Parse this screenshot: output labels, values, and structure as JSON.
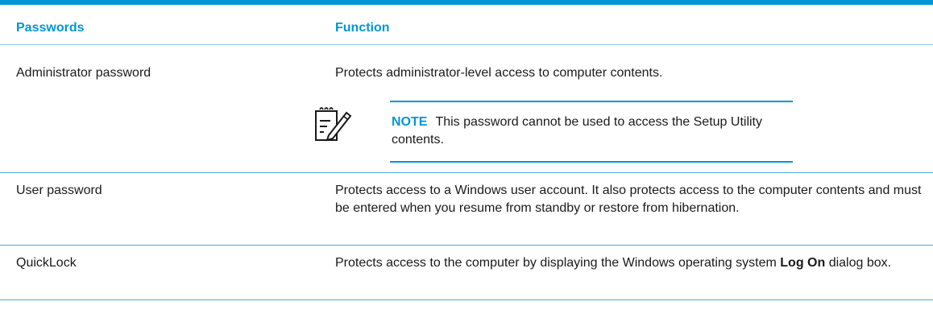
{
  "header": {
    "col_passwords": "Passwords",
    "col_function": "Function"
  },
  "rows": [
    {
      "password": "Administrator password",
      "function": "Protects administrator-level access to computer contents."
    },
    {
      "password": "User password",
      "function": "Protects access to a Windows user account. It also protects access to the computer contents and must be entered when you resume from standby or restore from hibernation."
    },
    {
      "password": "QuickLock",
      "function_prefix": "Protects access to the computer by displaying the Windows operating system",
      "function_bold": "Log On",
      "function_suffix": "dialog box."
    }
  ],
  "note": {
    "label": "NOTE",
    "text": "This password cannot be used to access the Setup Utility contents.",
    "icon": "note-pencil-icon"
  },
  "colors": {
    "accent": "#0096d6",
    "text": "#1a1a1a",
    "row_rule": "#4aa8dc"
  }
}
